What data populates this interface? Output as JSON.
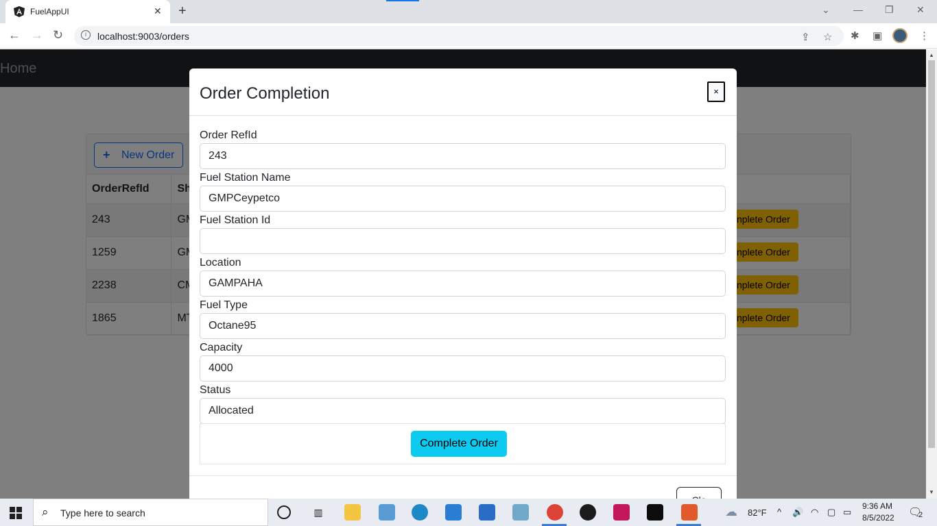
{
  "browser": {
    "tab_title": "FuelAppUI",
    "url": "localhost:9003/orders",
    "icons": [
      "angular-icon",
      "back-icon",
      "forward-icon",
      "reload-icon",
      "share-icon",
      "star-icon",
      "extensions-icon",
      "sidebar-icon",
      "menu-icon"
    ]
  },
  "navbar": {
    "brand": "Home"
  },
  "toolbar": {
    "new_order_label": "New Order"
  },
  "table": {
    "headers": [
      "OrderRefId",
      "Sh"
    ],
    "rows": [
      {
        "ref": "243",
        "station": "GM",
        "action": "nplete Order"
      },
      {
        "ref": "1259",
        "station": "GM",
        "action": "nplete Order"
      },
      {
        "ref": "2238",
        "station": "CM",
        "action": "nplete Order"
      },
      {
        "ref": "1865",
        "station": "MT",
        "action": "nplete Order"
      }
    ]
  },
  "modal": {
    "title": "Order Completion",
    "close_x": "×",
    "fields": [
      {
        "label": "Order RefId",
        "value": "243"
      },
      {
        "label": "Fuel Station Name",
        "value": "GMPCeypetco"
      },
      {
        "label": "Fuel Station Id",
        "value": ""
      },
      {
        "label": "Location",
        "value": "GAMPAHA"
      },
      {
        "label": "Fuel Type",
        "value": "Octane95"
      },
      {
        "label": "Capacity",
        "value": "4000"
      },
      {
        "label": "Status",
        "value": "Allocated"
      }
    ],
    "complete_label": "Complete Order",
    "close_label": "Clo"
  },
  "taskbar": {
    "search_placeholder": "Type here to search",
    "weather": "82°F",
    "time": "9:36 AM",
    "date": "8/5/2022",
    "notifications": "2"
  },
  "colors": {
    "navbar_bg": "#212529",
    "primary": "#0d6efd",
    "warning": "#ffc107",
    "info": "#0dcaf0"
  }
}
